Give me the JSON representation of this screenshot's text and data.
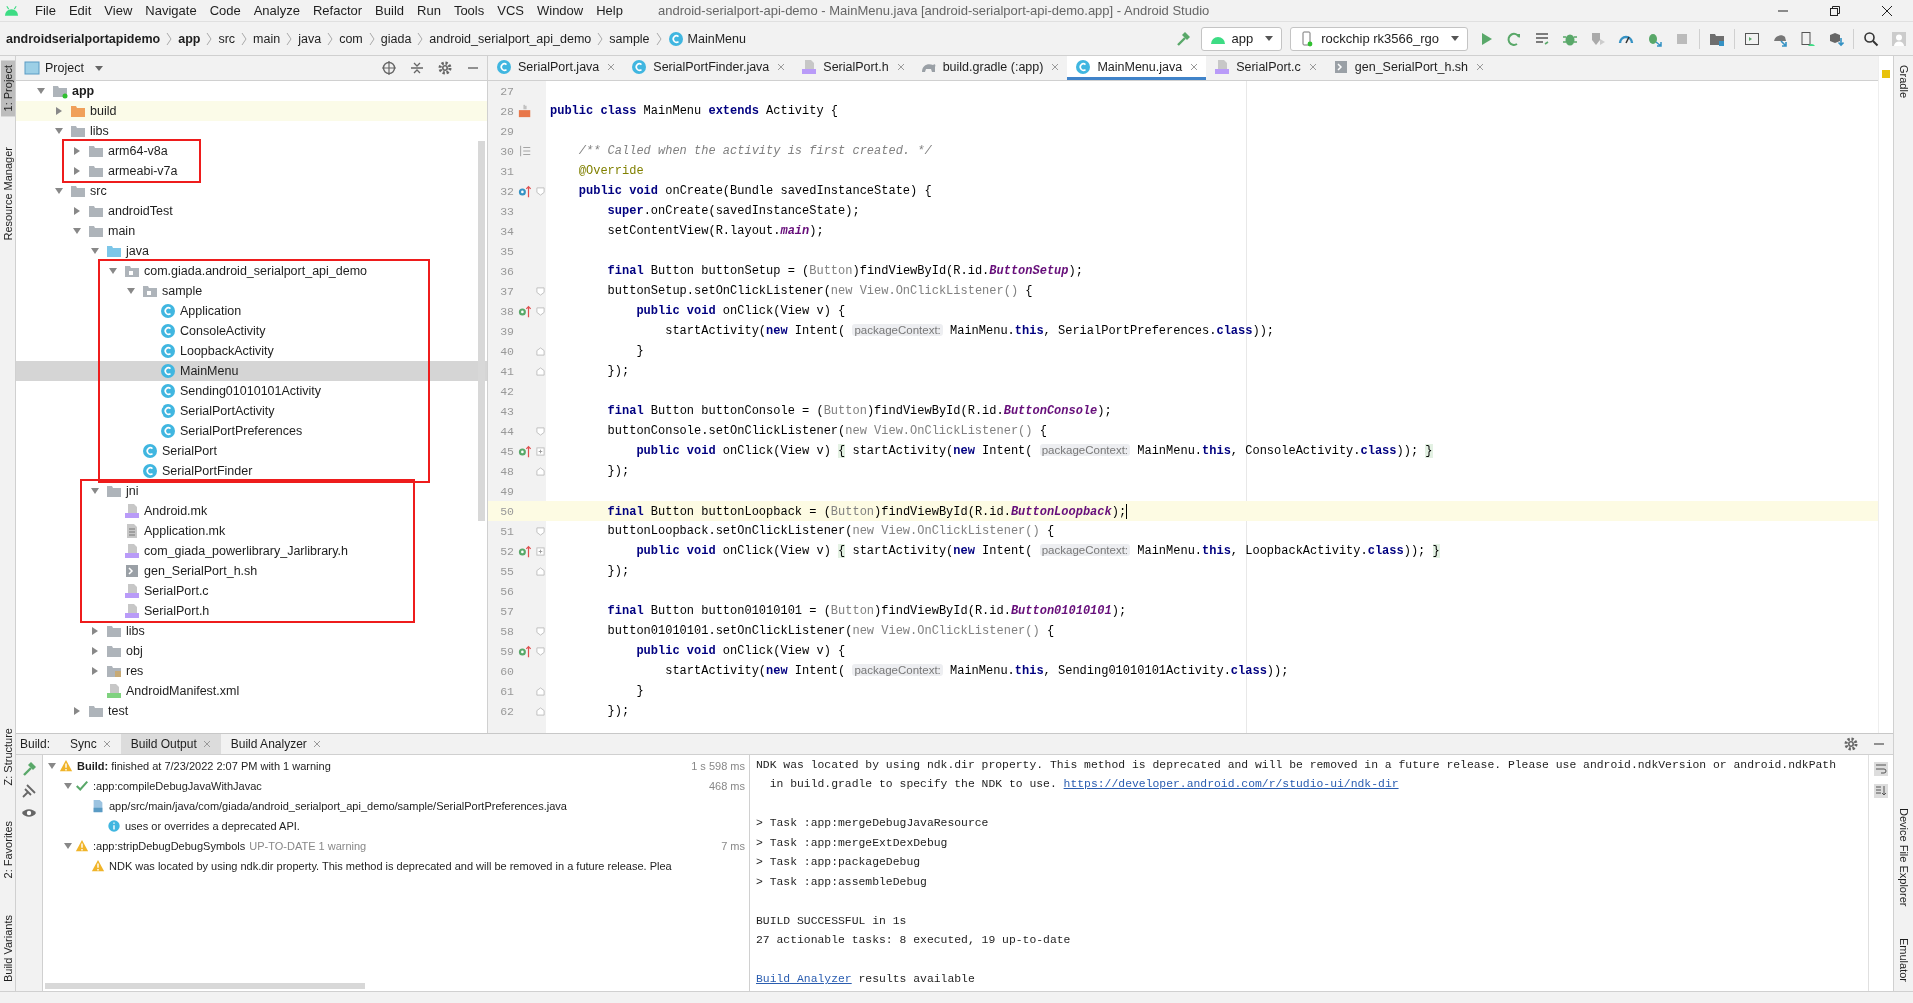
{
  "window": {
    "title": "android-serialport-api-demo - MainMenu.java [android-serialport-api-demo.app] - Android Studio"
  },
  "menu": [
    "File",
    "Edit",
    "View",
    "Navigate",
    "Code",
    "Analyze",
    "Refactor",
    "Build",
    "Run",
    "Tools",
    "VCS",
    "Window",
    "Help"
  ],
  "breadcrumbs": [
    {
      "label": "androidserialportapidemo",
      "kind": "project"
    },
    {
      "label": "app",
      "kind": "module"
    },
    {
      "label": "src",
      "kind": "folder"
    },
    {
      "label": "main",
      "kind": "folder"
    },
    {
      "label": "java",
      "kind": "folder"
    },
    {
      "label": "com",
      "kind": "folder"
    },
    {
      "label": "giada",
      "kind": "folder"
    },
    {
      "label": "android_serialport_api_demo",
      "kind": "folder"
    },
    {
      "label": "sample",
      "kind": "folder"
    },
    {
      "label": "MainMenu",
      "kind": "class"
    }
  ],
  "toolbar": {
    "run_config": "app",
    "device": "rockchip rk3566_rgo"
  },
  "left_tool_tabs": {
    "top": [
      {
        "label": "1: Project",
        "selected": true
      },
      {
        "label": "Resource Manager",
        "selected": false
      }
    ],
    "bottom": [
      {
        "label": "Z: Structure",
        "selected": false
      },
      {
        "label": "2: Favorites",
        "selected": false
      },
      {
        "label": "Build Variants",
        "selected": false
      }
    ]
  },
  "right_tool_tabs": {
    "top": [
      {
        "label": "Gradle",
        "selected": false
      }
    ],
    "bottom": [
      {
        "label": "Device File Explorer",
        "selected": false
      },
      {
        "label": "Emulator",
        "selected": false
      }
    ]
  },
  "project": {
    "view": "Project",
    "tree": [
      {
        "label": "app",
        "kind": "module",
        "selected": false,
        "expanded": true,
        "children": [
          {
            "label": "build",
            "kind": "folder-excluded",
            "selected": false,
            "expanded": false
          },
          {
            "label": "libs",
            "kind": "folder",
            "selected": false,
            "expanded": true,
            "children": [
              {
                "label": "arm64-v8a",
                "kind": "folder",
                "selected": false,
                "expanded": false,
                "boxed": true
              },
              {
                "label": "armeabi-v7a",
                "kind": "folder",
                "selected": false,
                "expanded": false,
                "boxed": true
              }
            ]
          },
          {
            "label": "src",
            "kind": "folder",
            "selected": false,
            "expanded": true,
            "children": [
              {
                "label": "androidTest",
                "kind": "folder",
                "selected": false,
                "expanded": false
              },
              {
                "label": "main",
                "kind": "folder",
                "selected": false,
                "expanded": true,
                "children": [
                  {
                    "label": "java",
                    "kind": "java-folder",
                    "selected": false,
                    "expanded": true,
                    "children": [
                      {
                        "label": "com.giada.android_serialport_api_demo",
                        "kind": "package",
                        "selected": false,
                        "expanded": true,
                        "boxed": true,
                        "children": [
                          {
                            "label": "sample",
                            "kind": "package",
                            "selected": false,
                            "expanded": true,
                            "children": [
                              {
                                "label": "Application",
                                "kind": "class",
                                "selected": false
                              },
                              {
                                "label": "ConsoleActivity",
                                "kind": "class",
                                "selected": false
                              },
                              {
                                "label": "LoopbackActivity",
                                "kind": "class",
                                "selected": false
                              },
                              {
                                "label": "MainMenu",
                                "kind": "class",
                                "selected": true
                              },
                              {
                                "label": "Sending01010101Activity",
                                "kind": "class",
                                "selected": false
                              },
                              {
                                "label": "SerialPortActivity",
                                "kind": "abstract-class",
                                "selected": false
                              },
                              {
                                "label": "SerialPortPreferences",
                                "kind": "class",
                                "selected": false
                              }
                            ]
                          },
                          {
                            "label": "SerialPort",
                            "kind": "class",
                            "selected": false
                          },
                          {
                            "label": "SerialPortFinder",
                            "kind": "class",
                            "selected": false
                          }
                        ]
                      }
                    ]
                  },
                  {
                    "label": "jni",
                    "kind": "folder",
                    "selected": false,
                    "expanded": true,
                    "boxed": true,
                    "children": [
                      {
                        "label": "Android.mk",
                        "kind": "cpp-file",
                        "selected": false
                      },
                      {
                        "label": "Application.mk",
                        "kind": "text-file",
                        "selected": false
                      },
                      {
                        "label": "com_giada_powerlibrary_Jarlibrary.h",
                        "kind": "cpp-file",
                        "selected": false
                      },
                      {
                        "label": "gen_SerialPort_h.sh",
                        "kind": "shell-file",
                        "selected": false
                      },
                      {
                        "label": "SerialPort.c",
                        "kind": "cpp-file",
                        "selected": false
                      },
                      {
                        "label": "SerialPort.h",
                        "kind": "cpp-file",
                        "selected": false
                      }
                    ]
                  },
                  {
                    "label": "libs",
                    "kind": "folder",
                    "selected": false,
                    "expanded": false
                  },
                  {
                    "label": "obj",
                    "kind": "folder",
                    "selected": false,
                    "expanded": false
                  },
                  {
                    "label": "res",
                    "kind": "res-folder",
                    "selected": false,
                    "expanded": false
                  },
                  {
                    "label": "AndroidManifest.xml",
                    "kind": "manifest",
                    "selected": false
                  }
                ]
              },
              {
                "label": "test",
                "kind": "folder",
                "selected": false,
                "expanded": false
              }
            ]
          }
        ]
      }
    ]
  },
  "editor_tabs": [
    {
      "label": "SerialPort.java",
      "kind": "class",
      "selected": false
    },
    {
      "label": "SerialPortFinder.java",
      "kind": "class",
      "selected": false
    },
    {
      "label": "SerialPort.h",
      "kind": "cpp-file",
      "selected": false
    },
    {
      "label": "build.gradle (:app)",
      "kind": "gradle",
      "selected": false
    },
    {
      "label": "MainMenu.java",
      "kind": "class",
      "selected": true
    },
    {
      "label": "SerialPort.c",
      "kind": "cpp-file",
      "selected": false
    },
    {
      "label": "gen_SerialPort_h.sh",
      "kind": "shell-file",
      "selected": false
    }
  ],
  "code": [
    {
      "number": "27",
      "current": false
    },
    {
      "number": "28",
      "current": false,
      "gutter": {
        "kind": "class-ref"
      },
      "tokens": [
        {
          "kind": "kw",
          "text": "public class"
        },
        {
          "kind": "plain",
          "text": " MainMenu "
        },
        {
          "kind": "kw",
          "text": "extends"
        },
        {
          "kind": "plain",
          "text": " Activity {"
        }
      ]
    },
    {
      "number": "29",
      "current": false
    },
    {
      "number": "30",
      "current": false,
      "gutter": {
        "kind": "doc"
      },
      "tokens": [
        {
          "kind": "comment",
          "text": "    /** Called when the activity is first created. */"
        }
      ]
    },
    {
      "number": "31",
      "current": false,
      "tokens": [
        {
          "kind": "annotation",
          "text": "    @Override"
        }
      ]
    },
    {
      "number": "32",
      "current": false,
      "gutter": {
        "kind": "overrides"
      },
      "fold": {
        "kind": "start"
      },
      "tokens": [
        {
          "kind": "kw",
          "text": "    public void"
        },
        {
          "kind": "plain",
          "text": " onCreate(Bundle savedInstanceState) {"
        }
      ]
    },
    {
      "number": "33",
      "current": false,
      "tokens": [
        {
          "kind": "kw",
          "text": "        super"
        },
        {
          "kind": "plain",
          "text": ".onCreate(savedInstanceState);"
        }
      ]
    },
    {
      "number": "34",
      "current": false,
      "tokens": [
        {
          "kind": "plain",
          "text": "        setContentView(R.layout."
        },
        {
          "kind": "field",
          "text": "main"
        },
        {
          "kind": "plain",
          "text": ");"
        }
      ]
    },
    {
      "number": "35",
      "current": false
    },
    {
      "number": "36",
      "current": false,
      "tokens": [
        {
          "kind": "kw",
          "text": "        final"
        },
        {
          "kind": "plain",
          "text": " Button buttonSetup = ("
        },
        {
          "kind": "dim",
          "text": "Button"
        },
        {
          "kind": "plain",
          "text": ")findViewById(R.id."
        },
        {
          "kind": "field",
          "text": "ButtonSetup"
        },
        {
          "kind": "plain",
          "text": ");"
        }
      ]
    },
    {
      "number": "37",
      "current": false,
      "fold": {
        "kind": "start"
      },
      "tokens": [
        {
          "kind": "plain",
          "text": "        buttonSetup.setOnClickListener("
        },
        {
          "kind": "dim",
          "text": "new View.OnClickListener()"
        },
        {
          "kind": "plain",
          "text": " {"
        }
      ]
    },
    {
      "number": "38",
      "current": false,
      "gutter": {
        "kind": "implements"
      },
      "fold": {
        "kind": "start"
      },
      "tokens": [
        {
          "kind": "kw",
          "text": "            public void"
        },
        {
          "kind": "plain",
          "text": " onClick(View v) {"
        }
      ]
    },
    {
      "number": "39",
      "current": false,
      "tokens": [
        {
          "kind": "plain",
          "text": "                startActivity("
        },
        {
          "kind": "kw",
          "text": "new"
        },
        {
          "kind": "plain",
          "text": " Intent( "
        },
        {
          "kind": "hint",
          "text": "packageContext:"
        },
        {
          "kind": "plain",
          "text": " MainMenu."
        },
        {
          "kind": "kw",
          "text": "this"
        },
        {
          "kind": "plain",
          "text": ", SerialPortPreferences."
        },
        {
          "kind": "kw",
          "text": "class"
        },
        {
          "kind": "plain",
          "text": "));"
        }
      ]
    },
    {
      "number": "40",
      "current": false,
      "fold": {
        "kind": "end"
      },
      "tokens": [
        {
          "kind": "plain",
          "text": "            }"
        }
      ]
    },
    {
      "number": "41",
      "current": false,
      "fold": {
        "kind": "end"
      },
      "tokens": [
        {
          "kind": "plain",
          "text": "        });"
        }
      ]
    },
    {
      "number": "42",
      "current": false
    },
    {
      "number": "43",
      "current": false,
      "tokens": [
        {
          "kind": "kw",
          "text": "        final"
        },
        {
          "kind": "plain",
          "text": " Button buttonConsole = ("
        },
        {
          "kind": "dim",
          "text": "Button"
        },
        {
          "kind": "plain",
          "text": ")findViewById(R.id."
        },
        {
          "kind": "field",
          "text": "ButtonConsole"
        },
        {
          "kind": "plain",
          "text": ");"
        }
      ]
    },
    {
      "number": "44",
      "current": false,
      "fold": {
        "kind": "start"
      },
      "tokens": [
        {
          "kind": "plain",
          "text": "        buttonConsole.setOnClickListener("
        },
        {
          "kind": "dim",
          "text": "new View.OnClickListener()"
        },
        {
          "kind": "plain",
          "text": " {"
        }
      ]
    },
    {
      "number": "45",
      "current": false,
      "gutter": {
        "kind": "implements"
      },
      "fold": {
        "kind": "collapsed"
      },
      "tokens": [
        {
          "kind": "kw",
          "text": "            public void"
        },
        {
          "kind": "plain",
          "text": " onClick(View v) "
        },
        {
          "kind": "folded",
          "text": "{"
        },
        {
          "kind": "plain",
          "text": " startActivity("
        },
        {
          "kind": "kw",
          "text": "new"
        },
        {
          "kind": "plain",
          "text": " Intent( "
        },
        {
          "kind": "hint",
          "text": "packageContext:"
        },
        {
          "kind": "plain",
          "text": " MainMenu."
        },
        {
          "kind": "kw",
          "text": "this"
        },
        {
          "kind": "plain",
          "text": ", ConsoleActivity."
        },
        {
          "kind": "kw",
          "text": "class"
        },
        {
          "kind": "plain",
          "text": ")); "
        },
        {
          "kind": "folded",
          "text": "}"
        }
      ]
    },
    {
      "number": "48",
      "current": false,
      "fold": {
        "kind": "end"
      },
      "tokens": [
        {
          "kind": "plain",
          "text": "        });"
        }
      ]
    },
    {
      "number": "49",
      "current": false
    },
    {
      "number": "50",
      "current": true,
      "tokens": [
        {
          "kind": "kw",
          "text": "        final"
        },
        {
          "kind": "plain",
          "text": " Button buttonLoopback = ("
        },
        {
          "kind": "dim",
          "text": "Button"
        },
        {
          "kind": "plain",
          "text": ")findViewById(R.id."
        },
        {
          "kind": "field",
          "text": "ButtonLoopback"
        },
        {
          "kind": "plain",
          "text": ");"
        }
      ]
    },
    {
      "number": "51",
      "current": false,
      "fold": {
        "kind": "start"
      },
      "tokens": [
        {
          "kind": "plain",
          "text": "        buttonLoopback.setOnClickListener("
        },
        {
          "kind": "dim",
          "text": "new View.OnClickListener()"
        },
        {
          "kind": "plain",
          "text": " {"
        }
      ]
    },
    {
      "number": "52",
      "current": false,
      "gutter": {
        "kind": "implements"
      },
      "fold": {
        "kind": "collapsed"
      },
      "tokens": [
        {
          "kind": "kw",
          "text": "            public void"
        },
        {
          "kind": "plain",
          "text": " onClick(View v) "
        },
        {
          "kind": "folded",
          "text": "{"
        },
        {
          "kind": "plain",
          "text": " startActivity("
        },
        {
          "kind": "kw",
          "text": "new"
        },
        {
          "kind": "plain",
          "text": " Intent( "
        },
        {
          "kind": "hint",
          "text": "packageContext:"
        },
        {
          "kind": "plain",
          "text": " MainMenu."
        },
        {
          "kind": "kw",
          "text": "this"
        },
        {
          "kind": "plain",
          "text": ", LoopbackActivity."
        },
        {
          "kind": "kw",
          "text": "class"
        },
        {
          "kind": "plain",
          "text": ")); "
        },
        {
          "kind": "folded",
          "text": "}"
        }
      ]
    },
    {
      "number": "55",
      "current": false,
      "fold": {
        "kind": "end"
      },
      "tokens": [
        {
          "kind": "plain",
          "text": "        });"
        }
      ]
    },
    {
      "number": "56",
      "current": false
    },
    {
      "number": "57",
      "current": false,
      "tokens": [
        {
          "kind": "kw",
          "text": "        final"
        },
        {
          "kind": "plain",
          "text": " Button button01010101 = ("
        },
        {
          "kind": "dim",
          "text": "Button"
        },
        {
          "kind": "plain",
          "text": ")findViewById(R.id."
        },
        {
          "kind": "field",
          "text": "Button01010101"
        },
        {
          "kind": "plain",
          "text": ");"
        }
      ]
    },
    {
      "number": "58",
      "current": false,
      "fold": {
        "kind": "start"
      },
      "tokens": [
        {
          "kind": "plain",
          "text": "        button01010101.setOnClickListener("
        },
        {
          "kind": "dim",
          "text": "new View.OnClickListener()"
        },
        {
          "kind": "plain",
          "text": " {"
        }
      ]
    },
    {
      "number": "59",
      "current": false,
      "gutter": {
        "kind": "implements"
      },
      "fold": {
        "kind": "start"
      },
      "tokens": [
        {
          "kind": "kw",
          "text": "            public void"
        },
        {
          "kind": "plain",
          "text": " onClick(View v) {"
        }
      ]
    },
    {
      "number": "60",
      "current": false,
      "tokens": [
        {
          "kind": "plain",
          "text": "                startActivity("
        },
        {
          "kind": "kw",
          "text": "new"
        },
        {
          "kind": "plain",
          "text": " Intent( "
        },
        {
          "kind": "hint",
          "text": "packageContext:"
        },
        {
          "kind": "plain",
          "text": " MainMenu."
        },
        {
          "kind": "kw",
          "text": "this"
        },
        {
          "kind": "plain",
          "text": ", Sending01010101Activity."
        },
        {
          "kind": "kw",
          "text": "class"
        },
        {
          "kind": "plain",
          "text": "));"
        }
      ]
    },
    {
      "number": "61",
      "current": false,
      "fold": {
        "kind": "end"
      },
      "tokens": [
        {
          "kind": "plain",
          "text": "            }"
        }
      ]
    },
    {
      "number": "62",
      "current": false,
      "fold": {
        "kind": "end"
      },
      "tokens": [
        {
          "kind": "plain",
          "text": "        });"
        }
      ]
    }
  ],
  "build": {
    "label": "Build:",
    "tabs": [
      {
        "label": "Sync",
        "selected": false
      },
      {
        "label": "Build Output",
        "selected": true
      },
      {
        "label": "Build Analyzer",
        "selected": false
      }
    ],
    "tree": [
      {
        "kind": "warning",
        "label": "**Build:** finished at 7/23/2022 2:07 PM with 1 warning",
        "time": "1 s 598 ms",
        "expanded": true,
        "children": [
          {
            "kind": "success",
            "label": ":app:compileDebugJavaWithJavac",
            "time": "468 ms",
            "expanded": true,
            "children": [
              {
                "kind": "file",
                "label": "app/src/main/java/com/giada/android_serialport_api_demo/sample/SerialPortPreferences.java",
                "children": [
                  {
                    "kind": "info",
                    "label": "uses or overrides a deprecated API."
                  }
                ]
              }
            ]
          },
          {
            "kind": "warning",
            "label": ":app:stripDebugDebugSymbols",
            "note": "UP-TO-DATE 1 warning",
            "time": "7 ms",
            "expanded": true,
            "children": [
              {
                "kind": "warning",
                "label": "NDK was located by using ndk.dir property. This method is deprecated and will be removed in a future release. Plea"
              }
            ]
          }
        ]
      }
    ],
    "console": [
      [
        {
          "parts": [
            {
              "kind": "text",
              "text": "NDK was located by using ndk.dir property. This method is deprecated and will be removed in a future release. Please use android.ndkVersion or android.ndkPath"
            }
          ]
        },
        {
          "parts": [
            {
              "kind": "text",
              "text": "  in build.gradle to specify the NDK to use. "
            },
            {
              "kind": "link",
              "text": "https://developer.android.com/r/studio-ui/ndk-dir"
            }
          ]
        }
      ],
      [
        {
          "parts": [
            {
              "kind": "text",
              "text": "> Task :app:mergeDebugJavaResource"
            }
          ]
        },
        {
          "parts": [
            {
              "kind": "text",
              "text": "> Task :app:mergeExtDexDebug"
            }
          ]
        },
        {
          "parts": [
            {
              "kind": "text",
              "text": "> Task :app:packageDebug"
            }
          ]
        },
        {
          "parts": [
            {
              "kind": "text",
              "text": "> Task :app:assembleDebug"
            }
          ]
        }
      ],
      [
        {
          "parts": [
            {
              "kind": "text",
              "text": "BUILD SUCCESSFUL in 1s"
            }
          ]
        },
        {
          "parts": [
            {
              "kind": "text",
              "text": "27 actionable tasks: 8 executed, 19 up-to-date"
            }
          ]
        }
      ],
      [
        {
          "parts": [
            {
              "kind": "link",
              "text": "Build Analyzer"
            },
            {
              "kind": "text",
              "text": " results available"
            }
          ]
        }
      ]
    ]
  }
}
